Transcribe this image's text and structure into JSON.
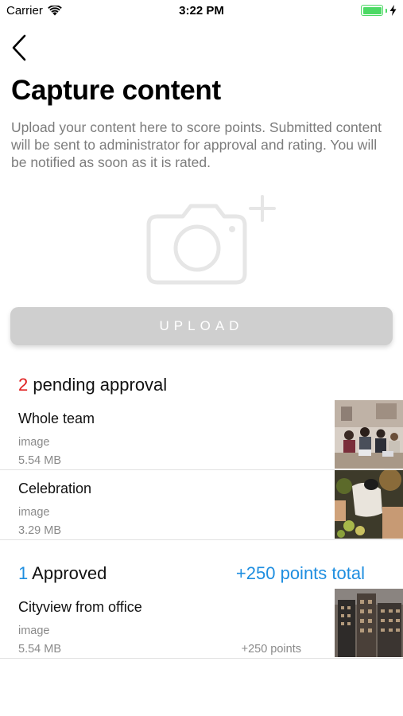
{
  "status_bar": {
    "carrier": "Carrier",
    "time": "3:22 PM",
    "wifi_icon": "wifi-icon",
    "battery_icon": "battery-icon",
    "charging_icon": "bolt-icon",
    "battery_level": 1.0,
    "battery_color": "#4cd964"
  },
  "header": {
    "back_icon": "chevron-left-icon",
    "title": "Capture content",
    "description": "Upload your content here to score points. Submitted content will be sent to administrator for approval and rating. You will be notified as soon as it is rated."
  },
  "capture": {
    "icon": "camera-add-icon"
  },
  "upload": {
    "label": "UPLOAD",
    "background": "#cfcfcf"
  },
  "pending": {
    "count": "2",
    "label": "pending approval",
    "count_color": "#e02020",
    "items": [
      {
        "title": "Whole team",
        "type": "image",
        "size": "5.54 MB",
        "thumb": "team-meeting-photo"
      },
      {
        "title": "Celebration",
        "type": "image",
        "size": "3.29 MB",
        "thumb": "celebration-photo"
      }
    ]
  },
  "approved": {
    "count": "1",
    "label": "Approved",
    "count_color": "#1e8ee0",
    "total": "+250 points total",
    "items": [
      {
        "title": "Cityview from office",
        "type": "image",
        "size": "5.54 MB",
        "points": "+250 points",
        "thumb": "city-buildings-photo"
      }
    ]
  }
}
